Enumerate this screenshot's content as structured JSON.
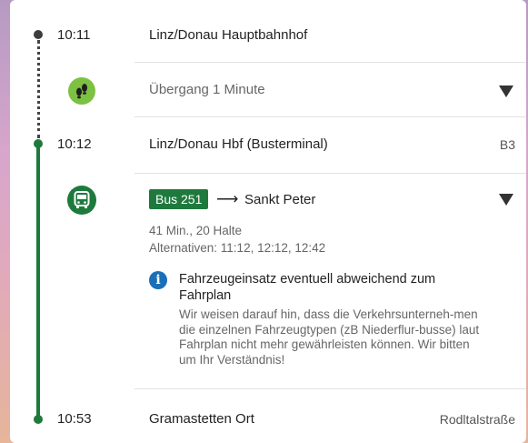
{
  "colors": {
    "line_green": "#1e7a3c",
    "walk_green": "#7cc142",
    "info_blue": "#1a6fb8"
  },
  "stops": [
    {
      "time": "10:11",
      "name": "Linz/Donau Hauptbahnhof",
      "platform": ""
    },
    {
      "time": "10:12",
      "name": "Linz/Donau Hbf (Busterminal)",
      "platform": "B3"
    },
    {
      "time": "10:53",
      "name": "Gramastetten Ort",
      "platform": "Rodltalstraße"
    }
  ],
  "transfer": {
    "icon": "footsteps-icon",
    "label": "Übergang 1 Minute",
    "expand_icon": "chevron-down-icon"
  },
  "bus_leg": {
    "icon": "bus-icon",
    "line": "Bus 251",
    "arrow": "⟶",
    "direction": "Sankt Peter",
    "duration": "41 Min., 20 Halte",
    "alternatives": "Alternativen: 11:12, 12:12, 12:42",
    "expand_icon": "chevron-down-icon"
  },
  "notice": {
    "icon": "info-icon",
    "title": "Fahrzeugeinsatz eventuell abweichend zum Fahrplan",
    "body": "Wir weisen darauf hin, dass die Verkehrsunterneh-men die einzelnen Fahrzeugtypen (zB Niederflur-busse) laut Fahrplan nicht mehr gewährleisten können. Wir bitten um Ihr Verständnis!"
  }
}
